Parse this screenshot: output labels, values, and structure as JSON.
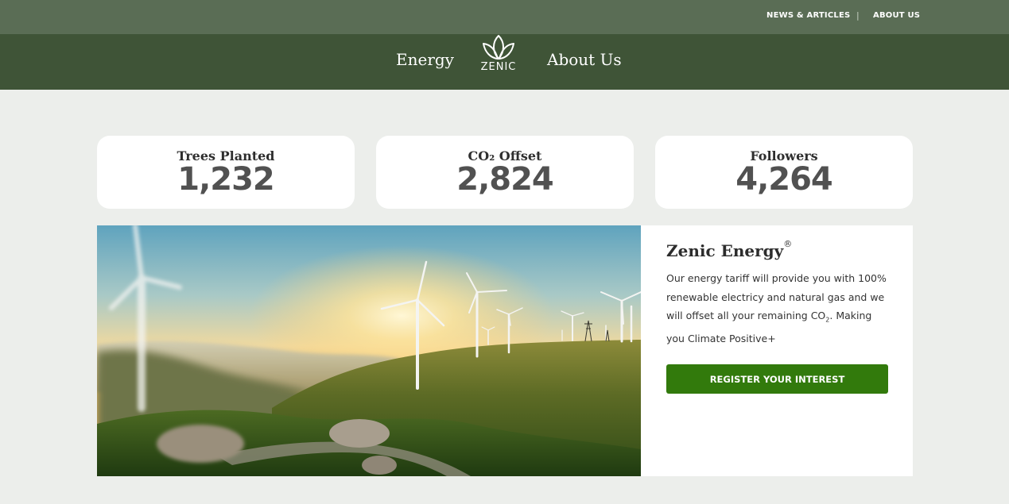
{
  "topbar": {
    "links": [
      "NEWS & ARTICLES",
      "ABOUT US"
    ],
    "separator": "|"
  },
  "nav": {
    "left_link": "Energy",
    "logo_text": "ZENIC",
    "right_link": "About Us"
  },
  "stats": [
    {
      "label": "Trees Planted",
      "value": "1,232"
    },
    {
      "label": "CO₂ Offset",
      "value": "2,824"
    },
    {
      "label": "Followers",
      "value": "4,264"
    }
  ],
  "hero": {
    "title": "Zenic Energy",
    "title_mark": "®",
    "desc_part1": "Our energy tariff will provide you with 100% renewable electricy and natural gas and we will offset all your remaining ",
    "desc_co2": "CO",
    "desc_co2_sub": "2",
    "desc_part2": ". Making you Climate Positive+",
    "cta_label": "REGISTER YOUR INTEREST"
  },
  "colors": {
    "topbar_bg": "#5a6d55",
    "nav_bg": "#3f5437",
    "page_bg": "#eceeeb",
    "cta_bg": "#327a0c"
  }
}
